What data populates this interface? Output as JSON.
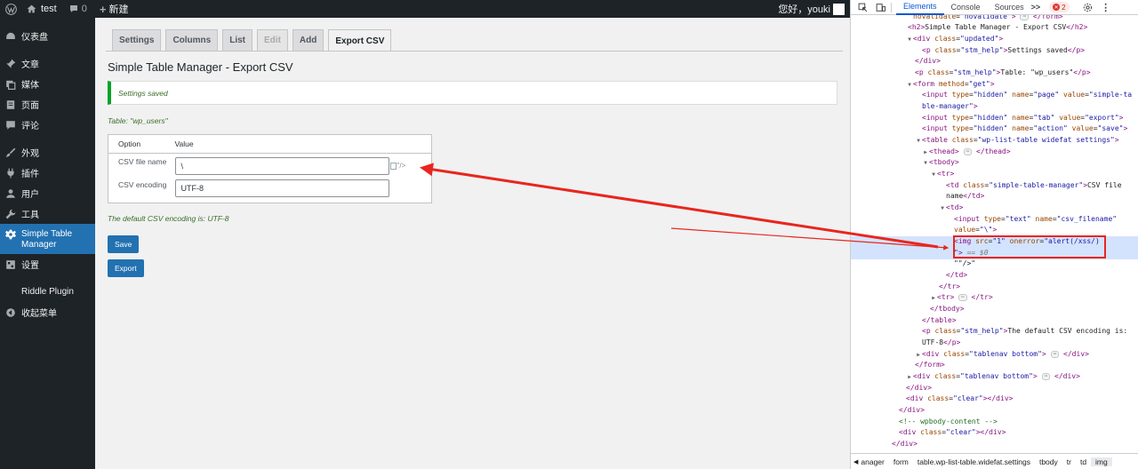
{
  "adminbar": {
    "site_name": "test",
    "comments_count": "0",
    "new_label": "新建",
    "greeting": "您好，youki"
  },
  "sidebar": {
    "items": [
      {
        "label": "仪表盘",
        "icon": "dashboard-icon"
      },
      {
        "label": "文章",
        "icon": "pin-icon"
      },
      {
        "label": "媒体",
        "icon": "media-icon"
      },
      {
        "label": "页面",
        "icon": "page-icon"
      },
      {
        "label": "评论",
        "icon": "comment-icon"
      },
      {
        "label": "外观",
        "icon": "brush-icon"
      },
      {
        "label": "插件",
        "icon": "plugin-icon"
      },
      {
        "label": "用户",
        "icon": "user-icon"
      },
      {
        "label": "工具",
        "icon": "wrench-icon"
      },
      {
        "label": "Simple Table Manager",
        "icon": "gear-icon"
      },
      {
        "label": "设置",
        "icon": "settings-grid-icon"
      },
      {
        "label": "Riddle Plugin",
        "icon": ""
      },
      {
        "label": "收起菜单",
        "icon": "collapse-icon"
      }
    ],
    "active_color": "#2271b1"
  },
  "main": {
    "tabs": [
      "Settings",
      "Columns",
      "List",
      "Edit",
      "Add",
      "Export CSV"
    ],
    "active_tab": "Export CSV",
    "title": "Simple Table Manager - Export CSV",
    "notice": "Settings saved",
    "table_label": "Table: \"wp_users\"",
    "table": {
      "headers": [
        "Option",
        "Value"
      ],
      "rows": [
        {
          "name": "CSV file name",
          "value": "\\"
        },
        {
          "name": "CSV encoding",
          "value": "UTF-8"
        }
      ]
    },
    "broken_img_text": "\"/>",
    "default_encoding": "The default CSV encoding is: UTF-8",
    "save_button": "Save",
    "export_button": "Export"
  },
  "devtools": {
    "tabs": [
      "Elements",
      "Console",
      "Sources"
    ],
    "active_tab": "Elements",
    "more": ">>",
    "error_count": "2",
    "breadcrumbs": [
      "anager",
      "form",
      "table.wp-list-table.widefat.settings",
      "tbody",
      "tr",
      "td",
      "img"
    ]
  },
  "colors": {
    "accent": "#2271b1",
    "admin_dark": "#1d2327",
    "success": "#00a32a",
    "annotation_red": "#e8261f"
  }
}
